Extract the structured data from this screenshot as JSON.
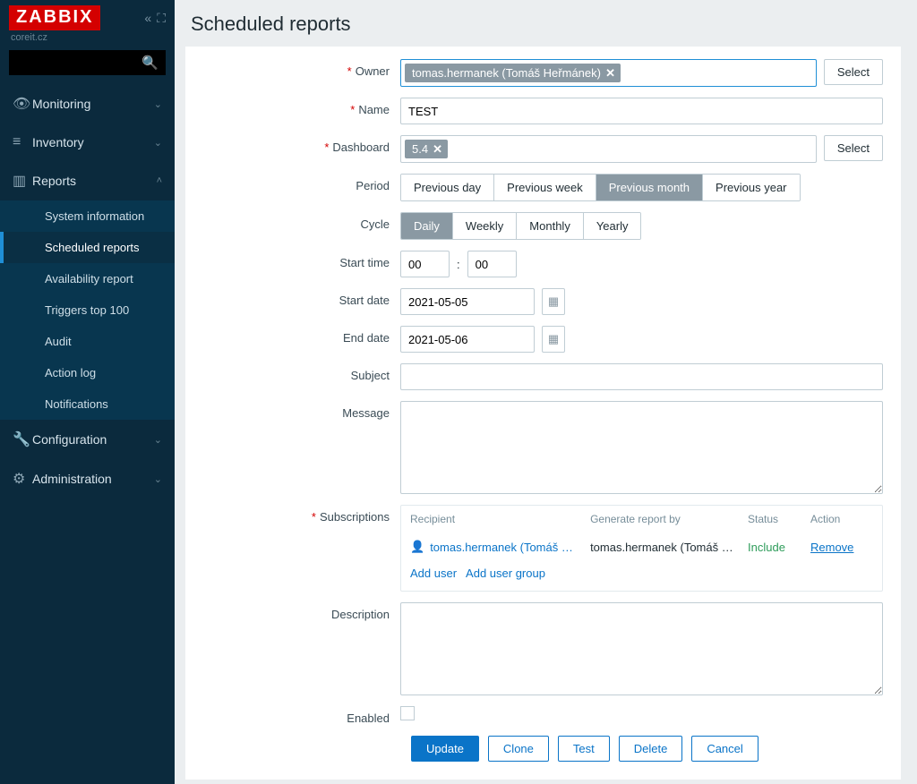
{
  "brand": {
    "logo": "ZABBIX",
    "host": "coreit.cz"
  },
  "sidebar_icons": {
    "collapse": "«",
    "kiosk": "⛶"
  },
  "search": {
    "placeholder": ""
  },
  "nav": [
    {
      "icon": "👁",
      "label": "Monitoring",
      "expanded": false
    },
    {
      "icon": "≡",
      "label": "Inventory",
      "expanded": false
    },
    {
      "icon": "▥",
      "label": "Reports",
      "expanded": true,
      "items": [
        "System information",
        "Scheduled reports",
        "Availability report",
        "Triggers top 100",
        "Audit",
        "Action log",
        "Notifications"
      ],
      "active": "Scheduled reports"
    },
    {
      "icon": "🔧",
      "label": "Configuration",
      "expanded": false
    },
    {
      "icon": "⚙",
      "label": "Administration",
      "expanded": false
    }
  ],
  "page": {
    "title": "Scheduled reports"
  },
  "form": {
    "labels": {
      "owner": "Owner",
      "name": "Name",
      "dashboard": "Dashboard",
      "period": "Period",
      "cycle": "Cycle",
      "start_time": "Start time",
      "start_date": "Start date",
      "end_date": "End date",
      "subject": "Subject",
      "message": "Message",
      "subscriptions": "Subscriptions",
      "description": "Description",
      "enabled": "Enabled"
    },
    "owner": {
      "tag": "tomas.hermanek (Tomáš Heřmánek)",
      "select": "Select"
    },
    "name": "TEST",
    "dashboard": {
      "tag": "5.4",
      "select": "Select"
    },
    "period": {
      "options": [
        "Previous day",
        "Previous week",
        "Previous month",
        "Previous year"
      ],
      "selected": "Previous month"
    },
    "cycle": {
      "options": [
        "Daily",
        "Weekly",
        "Monthly",
        "Yearly"
      ],
      "selected": "Daily"
    },
    "start_time": {
      "hh": "00",
      "mm": "00",
      "sep": ":"
    },
    "start_date": "2021-05-05",
    "end_date": "2021-05-06",
    "subject": "",
    "message": "",
    "subscriptions": {
      "columns": {
        "recipient": "Recipient",
        "generate": "Generate report by",
        "status": "Status",
        "action": "Action"
      },
      "rows": [
        {
          "recipient": "tomas.hermanek (Tomáš …",
          "generate": "tomas.hermanek (Tomáš …",
          "status": "Include",
          "action": "Remove"
        }
      ],
      "add_user": "Add user",
      "add_group": "Add user group"
    },
    "description": "",
    "enabled": false
  },
  "buttons": {
    "update": "Update",
    "clone": "Clone",
    "test": "Test",
    "delete": "Delete",
    "cancel": "Cancel"
  }
}
